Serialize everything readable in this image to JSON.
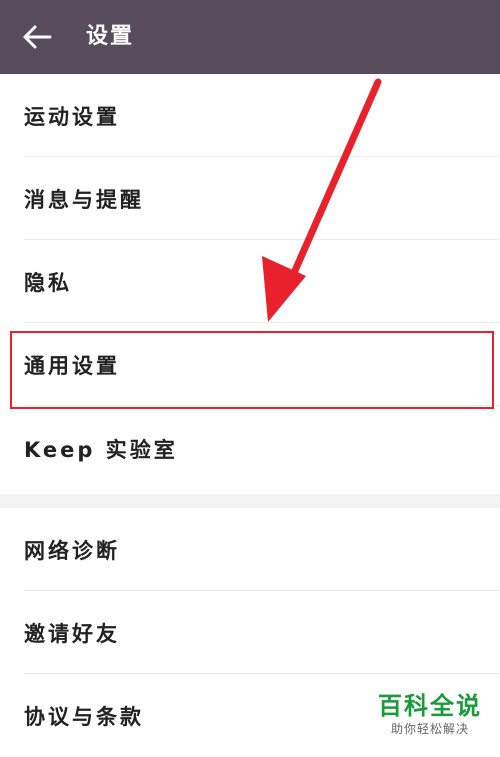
{
  "header": {
    "title": "设置",
    "back_icon": "arrow-left-icon",
    "bg_color": "#574c5c"
  },
  "groups": [
    {
      "items": [
        {
          "label": "运动设置"
        },
        {
          "label": "消息与提醒"
        },
        {
          "label": "隐私"
        },
        {
          "label": "通用设置"
        },
        {
          "label": "Keep 实验室"
        }
      ]
    },
    {
      "items": [
        {
          "label": "网络诊断"
        },
        {
          "label": "邀请好友"
        },
        {
          "label": "协议与条款"
        }
      ]
    }
  ],
  "annotation": {
    "highlight_color": "#e8212c",
    "highlighted_item": "通用设置"
  },
  "watermark": {
    "title": "百科全说",
    "subtitle": "助你轻松解决",
    "color": "#1a9a3a"
  }
}
